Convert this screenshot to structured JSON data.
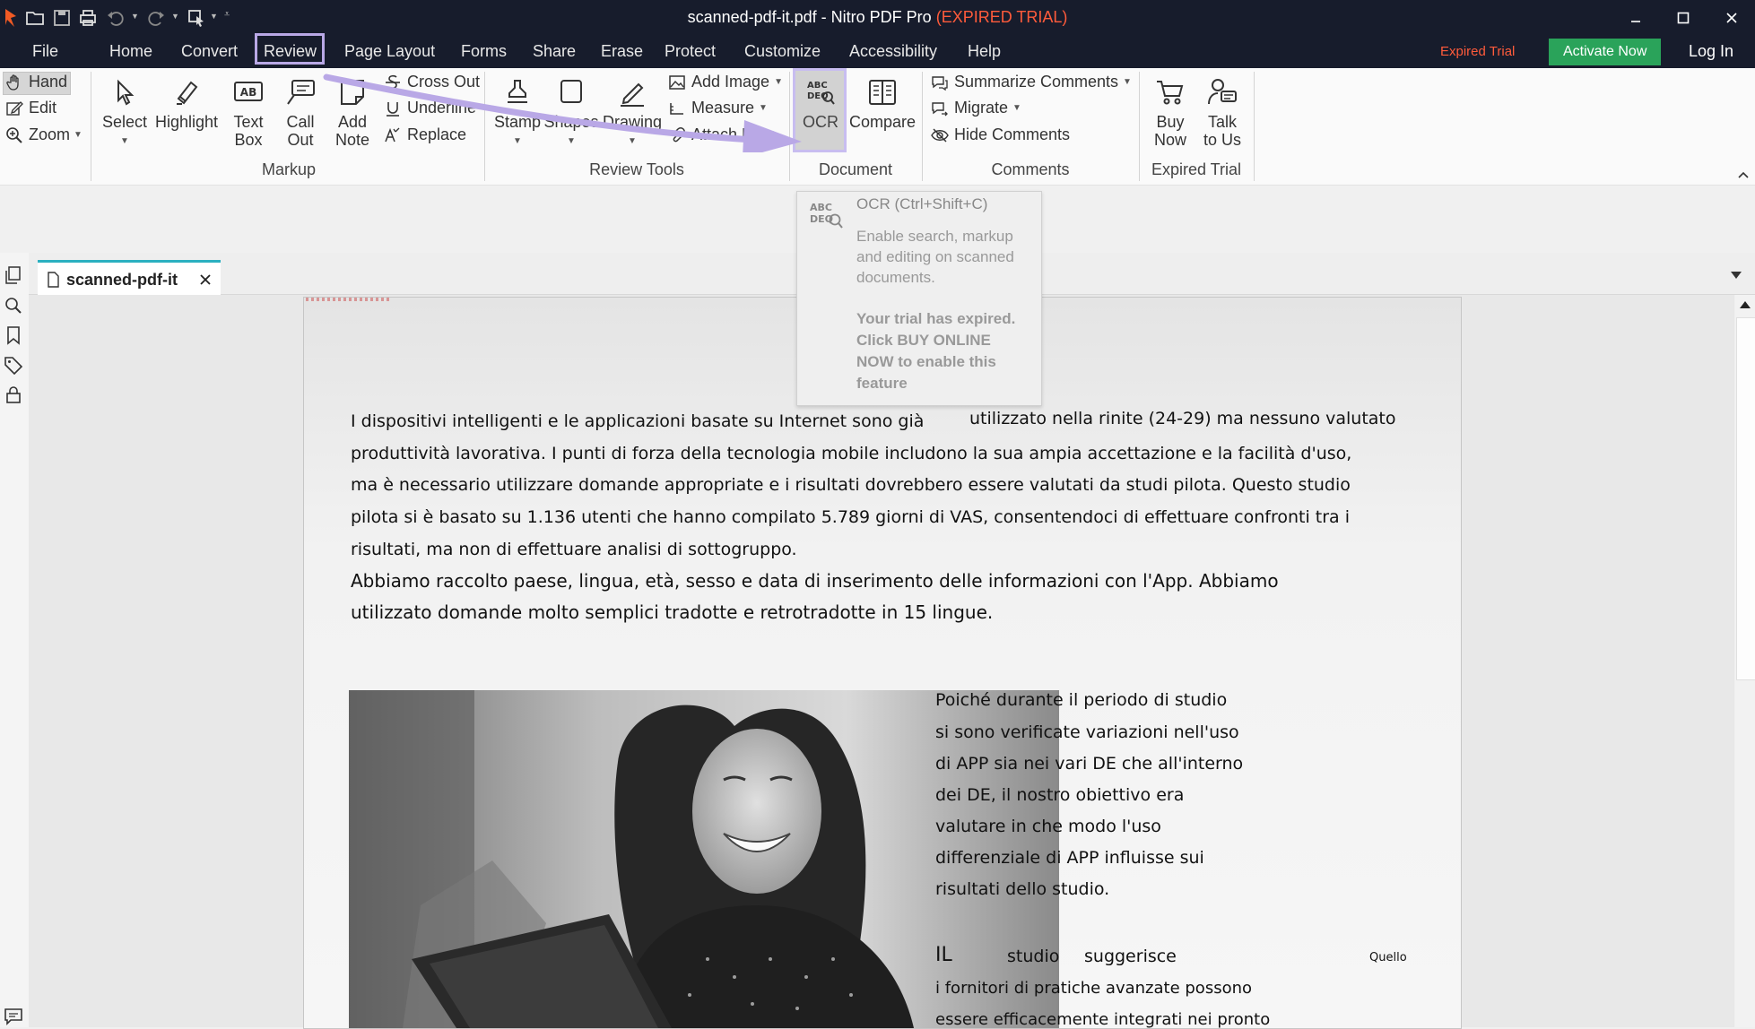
{
  "window": {
    "title": "scanned-pdf-it.pdf - Nitro PDF Pro",
    "trial_status": "(EXPIRED TRIAL)"
  },
  "menu": {
    "items": [
      "File",
      "Home",
      "Convert",
      "Review",
      "Page Layout",
      "Forms",
      "Share",
      "Erase",
      "Protect",
      "Customize",
      "Accessibility",
      "Help"
    ],
    "active": "Review",
    "expired_label": "Expired Trial",
    "activate_label": "Activate Now",
    "login_label": "Log In"
  },
  "ribbon": {
    "nav": {
      "hand": "Hand",
      "edit": "Edit",
      "zoom": "Zoom"
    },
    "markup": {
      "select": "Select",
      "highlight": "Highlight",
      "text_box": [
        "Text",
        "Box"
      ],
      "call_out": [
        "Call",
        "Out"
      ],
      "add_note": [
        "Add",
        "Note"
      ],
      "cross_out": "Cross Out",
      "underline": "Underline",
      "replace": "Replace",
      "label": "Markup"
    },
    "review_tools": {
      "stamp": "Stamp",
      "shapes": "Shapes",
      "drawing": "Drawing",
      "add_image": "Add Image",
      "measure": "Measure",
      "attach_files": "Attach Files",
      "label": "Review Tools"
    },
    "document": {
      "ocr": "OCR",
      "compare": "Compare",
      "label": "Document"
    },
    "comments": {
      "summarize": "Summarize Comments",
      "migrate": "Migrate",
      "hide": "Hide Comments",
      "label": "Comments"
    },
    "expired_trial": {
      "buy": [
        "Buy",
        "Now"
      ],
      "talk": [
        "Talk",
        "to Us"
      ],
      "label": "Expired Trial"
    }
  },
  "tooltip": {
    "icon_text": [
      "ABC",
      "DEQ"
    ],
    "title": "OCR (Ctrl+Shift+C)",
    "description": [
      "Enable search, markup",
      "and editing on scanned",
      "documents."
    ],
    "warning": [
      "Your trial has expired.",
      "Click BUY ONLINE",
      "NOW to enable this",
      "feature"
    ]
  },
  "tab": {
    "name": "scanned-pdf-it"
  },
  "document": {
    "para1": [
      "I dispositivi intelligenti e le applicazioni basate su Internet sono già",
      "utilizzato nella rinite (24-29) ma nessuno valutato",
      "produttività lavorativa. I punti di forza della tecnologia mobile includono la sua ampia accettazione e la facilità d'uso,",
      "ma è necessario utilizzare domande appropriate e i risultati dovrebbero essere valutati da studi pilota. Questo studio",
      "pilota si è basato su 1.136 utenti che hanno compilato 5.789 giorni di VAS, consentendoci di effettuare confronti tra i",
      "risultati, ma non di effettuare analisi di sottogruppo."
    ],
    "para2": [
      "Abbiamo raccolto paese, lingua, età, sesso e data di inserimento delle informazioni con l'App. Abbiamo",
      "utilizzato domande molto semplici tradotte e retrotradotte in 15 lingue."
    ],
    "para3": [
      "Poiché durante il periodo di studio",
      "si sono verificate variazioni nell'uso",
      "di APP sia nei vari DE che all'interno",
      "dei DE, il nostro obiettivo era",
      "valutare in che modo l'uso",
      "differenziale di APP influisse sui",
      "risultati dello studio."
    ],
    "para4_words": [
      "IL",
      "studio",
      "suggerisce",
      "Quello"
    ],
    "para4": [
      "i fornitori di pratiche avanzate possono",
      "essere efficacemente integrati nei pronto"
    ]
  },
  "colors": {
    "titlebar": "#171c2c",
    "accent_highlight": "#b9a8e6",
    "expired_red": "#ff5b3b",
    "activate_green": "#2aa35a",
    "tab_accent": "#2bb0c0"
  }
}
